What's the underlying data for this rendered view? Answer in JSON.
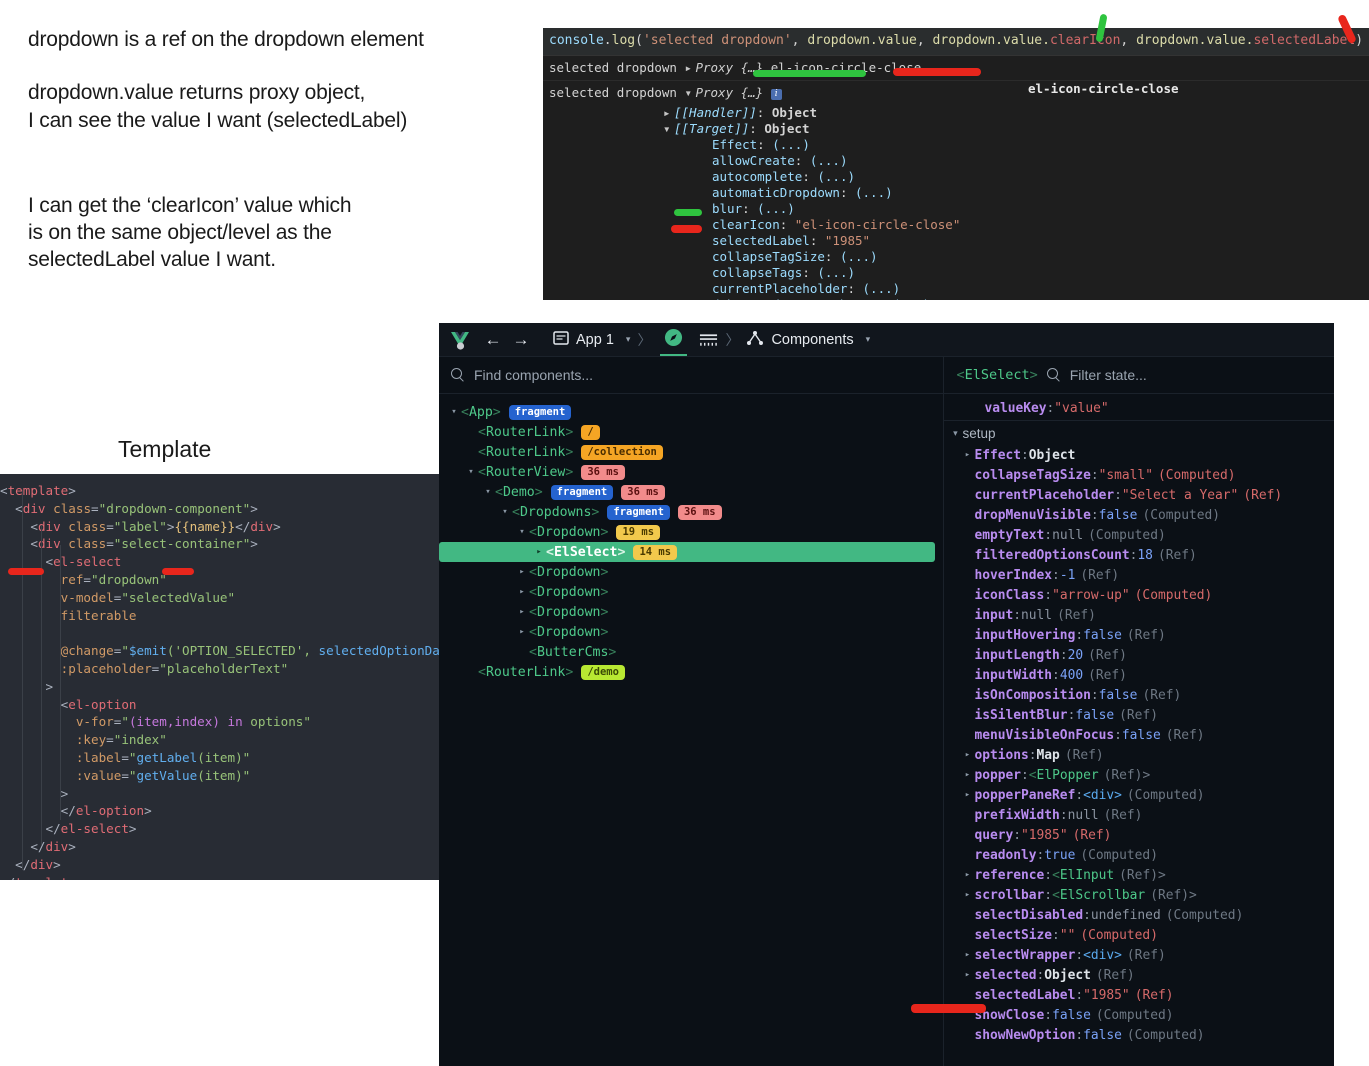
{
  "notes": {
    "paragraphs": [
      [
        "dropdown is a ref on the dropdown element"
      ],
      [
        "dropdown.value returns proxy object,",
        "I can see the value I want (selectedLabel)"
      ],
      [
        "I can get the ‘clearIcon’ value which",
        "is on the same object/level as the",
        "selectedLabel value I want."
      ]
    ]
  },
  "template_section": {
    "label": "Template",
    "code_lines": [
      "<template>",
      "  <div class=\"dropdown-component\">",
      "    <div class=\"label\">{{name}}</div>",
      "    <div class=\"select-container\">",
      "      <el-select",
      "        ref=\"dropdown\"",
      "        v-model=\"selectedValue\"",
      "        filterable",
      "",
      "        @change=\"$emit('OPTION_SELECTED', selectedOptionData())\"",
      "        :placeholder=\"placeholderText\"",
      "      >",
      "        <el-option",
      "          v-for=\"(item,index) in options\"",
      "          :key=\"index\"",
      "          :label=\"getLabel(item)\"",
      "          :value=\"getValue(item)\"",
      "        >",
      "        </el-option>",
      "      </el-select>",
      "    </div>",
      "  </div>",
      "</template>"
    ]
  },
  "console": {
    "command": "console.log('selected dropdown', dropdown.value, dropdown.value.clearIcon, dropdown.value.selectedLabel)",
    "command_parts": {
      "console": "console",
      "dot": ".",
      "log": "log",
      "open": "(",
      "arg_string": "'selected dropdown'",
      "comma": ", ",
      "arg2": "dropdown.value",
      "arg3_base": "dropdown.value.",
      "arg3_prop": "clearIcon",
      "arg4_base": "dropdown.value.",
      "arg4_prop": "selectedLabel",
      "close": ")"
    },
    "row1": {
      "label": "selected dropdown",
      "toggle": "▸",
      "proxy": "Proxy {…}",
      "value": "el-icon-circle-close"
    },
    "row2": {
      "label": "selected dropdown",
      "toggle": "▾",
      "proxy": "Proxy {…}",
      "info": "i",
      "right_value": "el-icon-circle-close"
    },
    "tree": [
      {
        "indent": 3,
        "toggle": "▸",
        "key": "[[Handler]]",
        "italic": true,
        "value": "Object",
        "value_type": "obj"
      },
      {
        "indent": 3,
        "toggle": "▾",
        "key": "[[Target]]",
        "italic": true,
        "value": "Object",
        "value_type": "obj"
      },
      {
        "indent": 4,
        "toggle": "",
        "key": "Effect",
        "italic": false,
        "value": "(...)",
        "value_type": "plain"
      },
      {
        "indent": 4,
        "toggle": "",
        "key": "allowCreate",
        "italic": false,
        "value": "(...)",
        "value_type": "plain"
      },
      {
        "indent": 4,
        "toggle": "",
        "key": "autocomplete",
        "italic": false,
        "value": "(...)",
        "value_type": "plain"
      },
      {
        "indent": 4,
        "toggle": "",
        "key": "automaticDropdown",
        "italic": false,
        "value": "(...)",
        "value_type": "plain"
      },
      {
        "indent": 4,
        "toggle": "",
        "key": "blur",
        "italic": false,
        "value": "(...)",
        "value_type": "plain"
      },
      {
        "indent": 4,
        "toggle": "",
        "key": "clearIcon",
        "italic": false,
        "value": "\"el-icon-circle-close\"",
        "value_type": "str"
      },
      {
        "indent": 4,
        "toggle": "",
        "key": "selectedLabel",
        "italic": false,
        "value": "\"1985\"",
        "value_type": "str"
      },
      {
        "indent": 4,
        "toggle": "",
        "key": "collapseTagSize",
        "italic": false,
        "value": "(...)",
        "value_type": "plain"
      },
      {
        "indent": 4,
        "toggle": "",
        "key": "collapseTags",
        "italic": false,
        "value": "(...)",
        "value_type": "plain"
      },
      {
        "indent": 4,
        "toggle": "",
        "key": "currentPlaceholder",
        "italic": false,
        "value": "(...)",
        "value_type": "plain"
      },
      {
        "indent": 4,
        "toggle": "",
        "key": "debouncedOnInputChange",
        "italic": false,
        "value": "(...)",
        "value_type": "plain"
      }
    ]
  },
  "devtools": {
    "toolbar": {
      "app_label": "App 1",
      "page_label": "Components",
      "back_icon": "←",
      "forward_icon": "→",
      "caret": "▾",
      "separator": "〉"
    },
    "search_placeholder": "Find components...",
    "tree": [
      {
        "depth": 0,
        "toggle": "▾",
        "name": "App",
        "badges": [
          {
            "text": "fragment",
            "style": "frag"
          }
        ],
        "selected": false
      },
      {
        "depth": 1,
        "toggle": "",
        "name": "RouterLink",
        "badges": [
          {
            "text": "/",
            "style": "route"
          }
        ],
        "selected": false
      },
      {
        "depth": 1,
        "toggle": "",
        "name": "RouterLink",
        "badges": [
          {
            "text": "/collection",
            "style": "route"
          }
        ],
        "selected": false
      },
      {
        "depth": 1,
        "toggle": "▾",
        "name": "RouterView",
        "badges": [
          {
            "text": "36 ms",
            "style": "ms-red"
          }
        ],
        "selected": false
      },
      {
        "depth": 2,
        "toggle": "▾",
        "name": "Demo",
        "badges": [
          {
            "text": "fragment",
            "style": "frag"
          },
          {
            "text": "36 ms",
            "style": "ms-red"
          }
        ],
        "selected": false
      },
      {
        "depth": 3,
        "toggle": "▾",
        "name": "Dropdowns",
        "badges": [
          {
            "text": "fragment",
            "style": "frag"
          },
          {
            "text": "36 ms",
            "style": "ms-red"
          }
        ],
        "selected": false
      },
      {
        "depth": 4,
        "toggle": "▾",
        "name": "Dropdown",
        "badges": [
          {
            "text": "19 ms",
            "style": "ms-yel"
          }
        ],
        "selected": false
      },
      {
        "depth": 5,
        "toggle": "▸",
        "name": "ElSelect",
        "badges": [
          {
            "text": "14 ms",
            "style": "ms-yel"
          }
        ],
        "selected": true
      },
      {
        "depth": 4,
        "toggle": "▸",
        "name": "Dropdown",
        "badges": [],
        "selected": false
      },
      {
        "depth": 4,
        "toggle": "▸",
        "name": "Dropdown",
        "badges": [],
        "selected": false
      },
      {
        "depth": 4,
        "toggle": "▸",
        "name": "Dropdown",
        "badges": [],
        "selected": false
      },
      {
        "depth": 4,
        "toggle": "▸",
        "name": "Dropdown",
        "badges": [],
        "selected": false
      },
      {
        "depth": 4,
        "toggle": "",
        "name": "ButterCms",
        "badges": [],
        "selected": false
      },
      {
        "depth": 1,
        "toggle": "",
        "name": "RouterLink",
        "badges": [
          {
            "text": "/demo",
            "style": "demo"
          }
        ],
        "selected": false
      }
    ],
    "state_panel": {
      "component_name": "ElSelect",
      "filter_placeholder": "Filter state...",
      "group_label": "setup",
      "top_row": {
        "key": "valueKey",
        "value": "\"value\"",
        "type": "str",
        "meta": ""
      },
      "rows": [
        {
          "toggle": "▸",
          "key": "Effect",
          "value": "Object",
          "type": "obj",
          "meta": "",
          "indent": 1
        },
        {
          "toggle": "",
          "key": "collapseTagSize",
          "value": "\"small\"",
          "type": "str",
          "meta": "(Computed)",
          "metaRed": true,
          "indent": 1
        },
        {
          "toggle": "",
          "key": "currentPlaceholder",
          "value": "\"Select a Year\"",
          "type": "str",
          "meta": "(Ref)",
          "metaRed": true,
          "indent": 1
        },
        {
          "toggle": "",
          "key": "dropMenuVisible",
          "value": "false",
          "type": "bool",
          "meta": "(Computed)",
          "indent": 1
        },
        {
          "toggle": "",
          "key": "emptyText",
          "value": "null",
          "type": "null",
          "meta": "(Computed)",
          "indent": 1
        },
        {
          "toggle": "",
          "key": "filteredOptionsCount",
          "value": "18",
          "type": "num",
          "meta": "(Ref)",
          "indent": 1
        },
        {
          "toggle": "",
          "key": "hoverIndex",
          "value": "-1",
          "type": "num",
          "meta": "(Ref)",
          "indent": 1
        },
        {
          "toggle": "",
          "key": "iconClass",
          "value": "\"arrow-up\"",
          "type": "str",
          "meta": "(Computed)",
          "metaRed": true,
          "indent": 1
        },
        {
          "toggle": "",
          "key": "input",
          "value": "null",
          "type": "null",
          "meta": "(Ref)",
          "indent": 1
        },
        {
          "toggle": "",
          "key": "inputHovering",
          "value": "false",
          "type": "bool",
          "meta": "(Ref)",
          "indent": 1
        },
        {
          "toggle": "",
          "key": "inputLength",
          "value": "20",
          "type": "num",
          "meta": "(Ref)",
          "indent": 1
        },
        {
          "toggle": "",
          "key": "inputWidth",
          "value": "400",
          "type": "num",
          "meta": "(Ref)",
          "indent": 1
        },
        {
          "toggle": "",
          "key": "isOnComposition",
          "value": "false",
          "type": "bool",
          "meta": "(Ref)",
          "indent": 1
        },
        {
          "toggle": "",
          "key": "isSilentBlur",
          "value": "false",
          "type": "bool",
          "meta": "(Ref)",
          "indent": 1
        },
        {
          "toggle": "",
          "key": "menuVisibleOnFocus",
          "value": "false",
          "type": "bool",
          "meta": "(Ref)",
          "indent": 1
        },
        {
          "toggle": "▸",
          "key": "options",
          "value": "Map",
          "type": "obj",
          "meta": "(Ref)",
          "indent": 1
        },
        {
          "toggle": "▸",
          "key": "popper",
          "value": "<ElPopper",
          "type": "tag",
          "meta": "(Ref)>",
          "indent": 1
        },
        {
          "toggle": "▸",
          "key": "popperPaneRef",
          "value": "<div>",
          "type": "div",
          "meta": "(Computed)",
          "indent": 1
        },
        {
          "toggle": "",
          "key": "prefixWidth",
          "value": "null",
          "type": "null",
          "meta": "(Ref)",
          "indent": 1
        },
        {
          "toggle": "",
          "key": "query",
          "value": "\"1985\"",
          "type": "str",
          "meta": "(Ref)",
          "metaRed": true,
          "indent": 1
        },
        {
          "toggle": "",
          "key": "readonly",
          "value": "true",
          "type": "bool",
          "meta": "(Computed)",
          "indent": 1
        },
        {
          "toggle": "▸",
          "key": "reference",
          "value": "<ElInput",
          "type": "tag",
          "meta": "(Ref)>",
          "indent": 1
        },
        {
          "toggle": "▸",
          "key": "scrollbar",
          "value": "<ElScrollbar",
          "type": "tag",
          "meta": "(Ref)>",
          "indent": 1
        },
        {
          "toggle": "",
          "key": "selectDisabled",
          "value": "undefined",
          "type": "null",
          "meta": "(Computed)",
          "indent": 1
        },
        {
          "toggle": "",
          "key": "selectSize",
          "value": "\"\"",
          "type": "str",
          "meta": "(Computed)",
          "metaRed": true,
          "indent": 1
        },
        {
          "toggle": "▸",
          "key": "selectWrapper",
          "value": "<div>",
          "type": "div",
          "meta": "(Ref)",
          "indent": 1
        },
        {
          "toggle": "▸",
          "key": "selected",
          "value": "Object",
          "type": "obj",
          "meta": "(Ref)",
          "indent": 1
        },
        {
          "toggle": "",
          "key": "selectedLabel",
          "value": "\"1985\"",
          "type": "str",
          "meta": "(Ref)",
          "metaRed": true,
          "indent": 1
        },
        {
          "toggle": "",
          "key": "showClose",
          "value": "false",
          "type": "bool",
          "meta": "(Computed)",
          "indent": 1
        },
        {
          "toggle": "",
          "key": "showNewOption",
          "value": "false",
          "type": "bool",
          "meta": "(Computed)",
          "indent": 1
        }
      ]
    }
  },
  "colors": {
    "accent_green": "#42b883",
    "mark_red": "#e8261c",
    "mark_green": "#2fc43f",
    "devtools_bg": "#0b1016",
    "console_bg": "#1e1e1e",
    "code_bg": "#282c34"
  }
}
